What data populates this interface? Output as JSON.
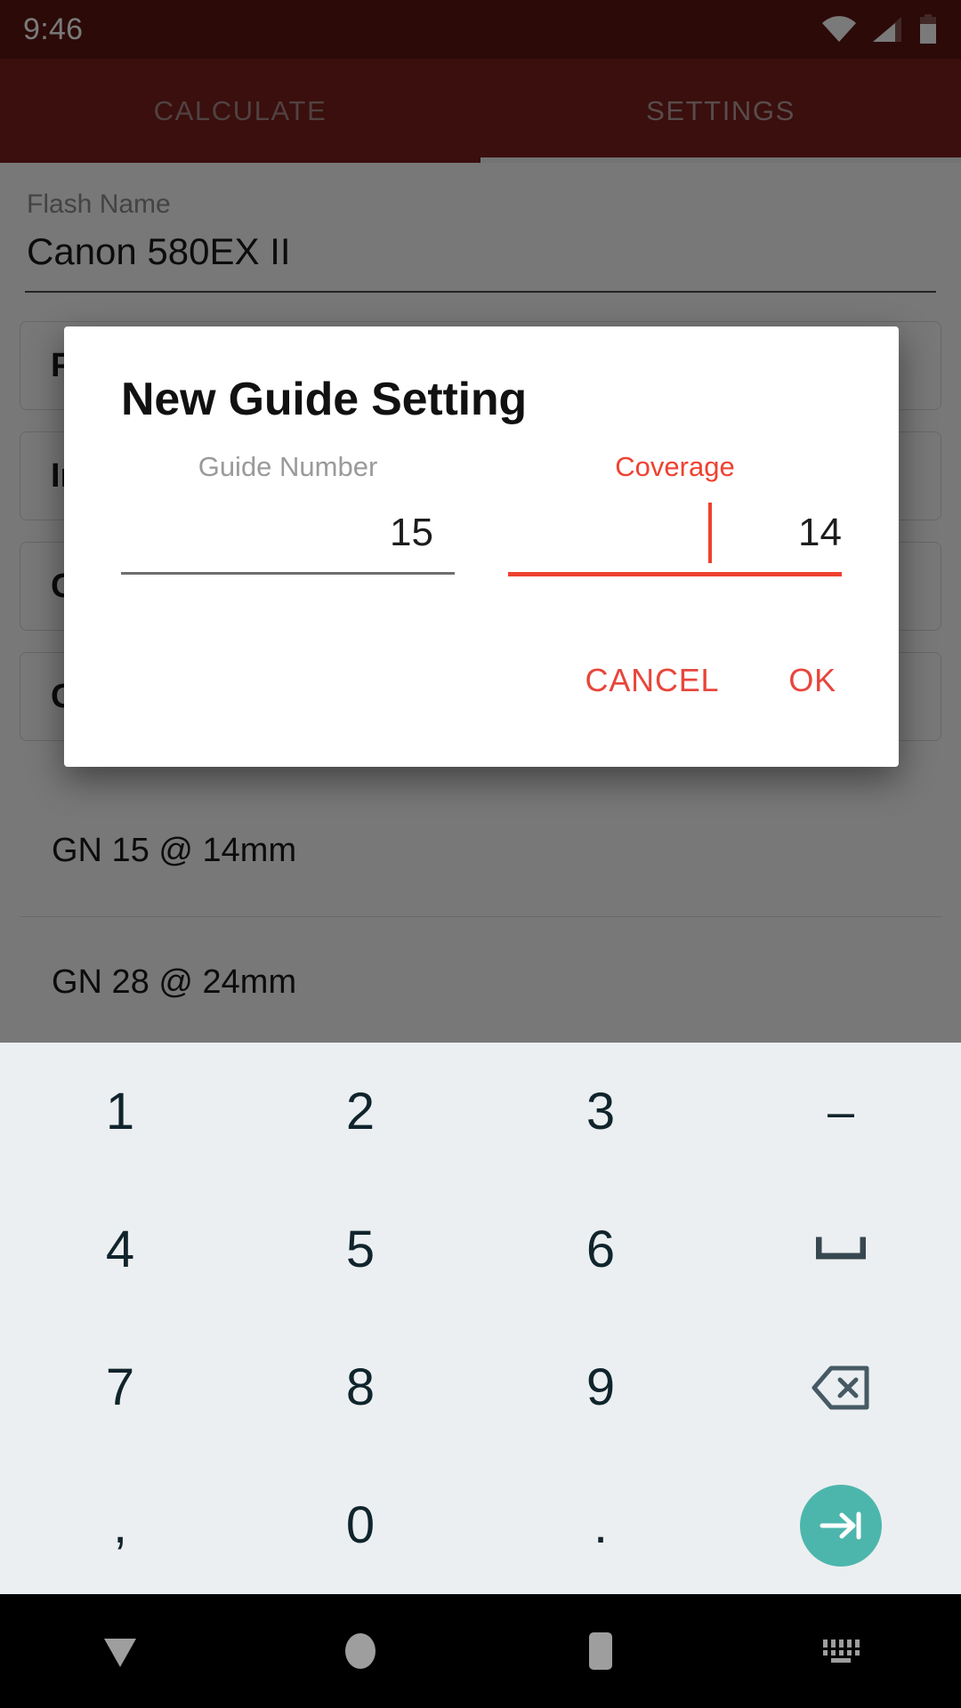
{
  "status_bar": {
    "time": "9:46",
    "icons": [
      "wifi-icon",
      "cellular-signal-icon",
      "battery-icon"
    ]
  },
  "app_bar": {
    "accent_color": "#7a211c",
    "status_color": "#5a1512",
    "tabs": [
      {
        "label": "CALCULATE",
        "active": false
      },
      {
        "label": "SETTINGS",
        "active": true
      }
    ]
  },
  "settings": {
    "flash_name_label": "Flash Name",
    "flash_name_value": "Canon 580EX II",
    "cards": [
      {
        "label": "P"
      },
      {
        "label": "In"
      },
      {
        "label": "G"
      },
      {
        "label": "G"
      }
    ],
    "guide_numbers": [
      {
        "label": "GN 15  @  14mm"
      },
      {
        "label": "GN 28  @  24mm"
      }
    ]
  },
  "dialog": {
    "title": "New Guide Setting",
    "accent_color": "#ef4130",
    "fields": [
      {
        "label": "Guide Number",
        "value": "15",
        "placeholder": "",
        "focused": false
      },
      {
        "label": "Coverage",
        "value": "14",
        "placeholder": "",
        "focused": true
      }
    ],
    "cancel_label": "CANCEL",
    "ok_label": "OK"
  },
  "keyboard": {
    "background_color": "#eceff1",
    "enter_color": "#4db6ac",
    "rows": [
      [
        {
          "label": "1",
          "name": "key-1"
        },
        {
          "label": "2",
          "name": "key-2"
        },
        {
          "label": "3",
          "name": "key-3"
        },
        {
          "label": "–",
          "name": "key-dash"
        }
      ],
      [
        {
          "label": "4",
          "name": "key-4"
        },
        {
          "label": "5",
          "name": "key-5"
        },
        {
          "label": "6",
          "name": "key-6"
        },
        {
          "label": "⌴",
          "name": "key-space"
        }
      ],
      [
        {
          "label": "7",
          "name": "key-7"
        },
        {
          "label": "8",
          "name": "key-8"
        },
        {
          "label": "9",
          "name": "key-9"
        },
        {
          "label": "",
          "name": "key-backspace"
        }
      ],
      [
        {
          "label": ",",
          "name": "key-comma"
        },
        {
          "label": "0",
          "name": "key-0"
        },
        {
          "label": ".",
          "name": "key-period"
        },
        {
          "label": "",
          "name": "key-enter"
        }
      ]
    ]
  },
  "nav_bar": {
    "buttons": [
      "back-icon",
      "home-icon",
      "recents-icon",
      "keyboard-switcher-icon"
    ]
  }
}
